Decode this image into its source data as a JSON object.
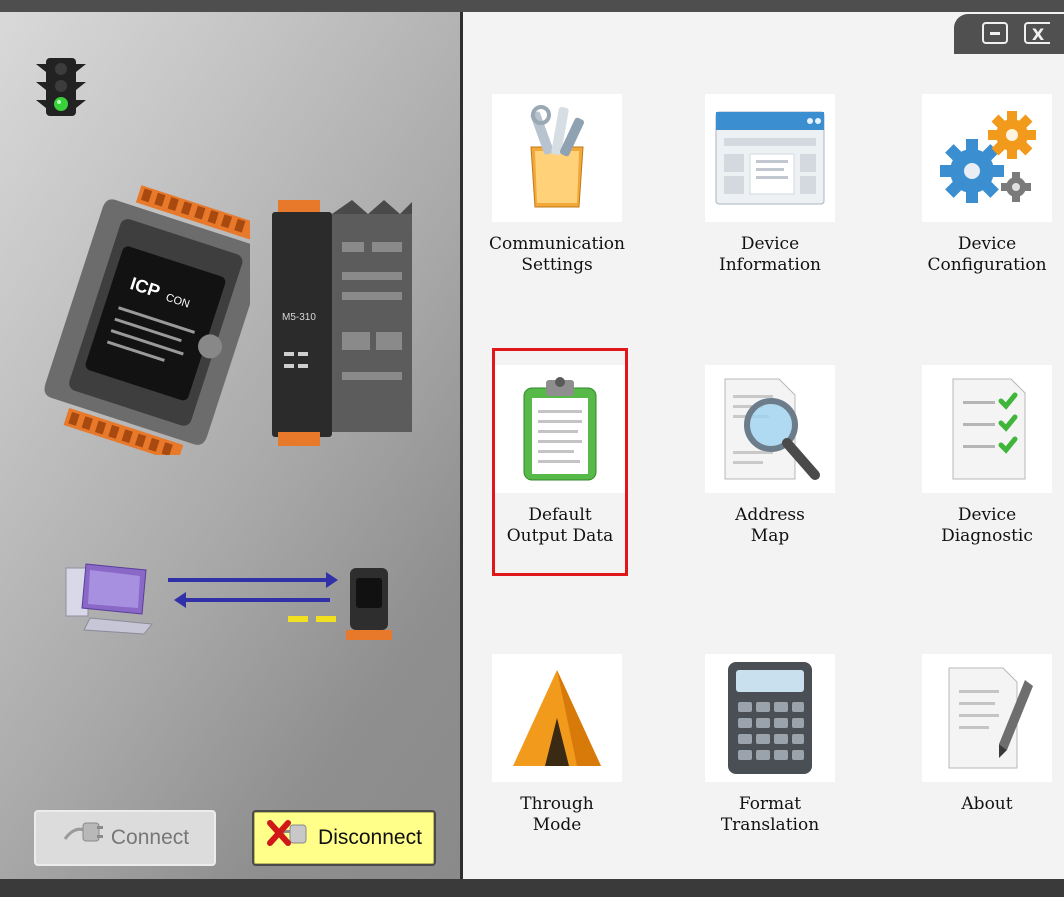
{
  "window": {
    "minimize_label": "",
    "close_label": "X"
  },
  "left_panel": {
    "connect_label": "Connect",
    "disconnect_label": "Disconnect",
    "status_light": "green"
  },
  "menu": [
    {
      "label": "Communication\nSettings",
      "icon": "communication-settings-icon"
    },
    {
      "label": "Device\nInformation",
      "icon": "device-information-icon"
    },
    {
      "label": "Device\nConfiguration",
      "icon": "device-configuration-icon"
    },
    {
      "label": "Default\nOutput Data",
      "icon": "default-output-data-icon",
      "selected": true
    },
    {
      "label": "Address\nMap",
      "icon": "address-map-icon"
    },
    {
      "label": "Device\nDiagnostic",
      "icon": "device-diagnostic-icon"
    },
    {
      "label": "Through\nMode",
      "icon": "through-mode-icon"
    },
    {
      "label": "Format\nTranslation",
      "icon": "format-translation-icon"
    },
    {
      "label": "About",
      "icon": "about-icon"
    }
  ],
  "colors": {
    "selection": "#e0161b",
    "disconnect_bg": "#ffff8a",
    "status_green": "#39d13a"
  }
}
